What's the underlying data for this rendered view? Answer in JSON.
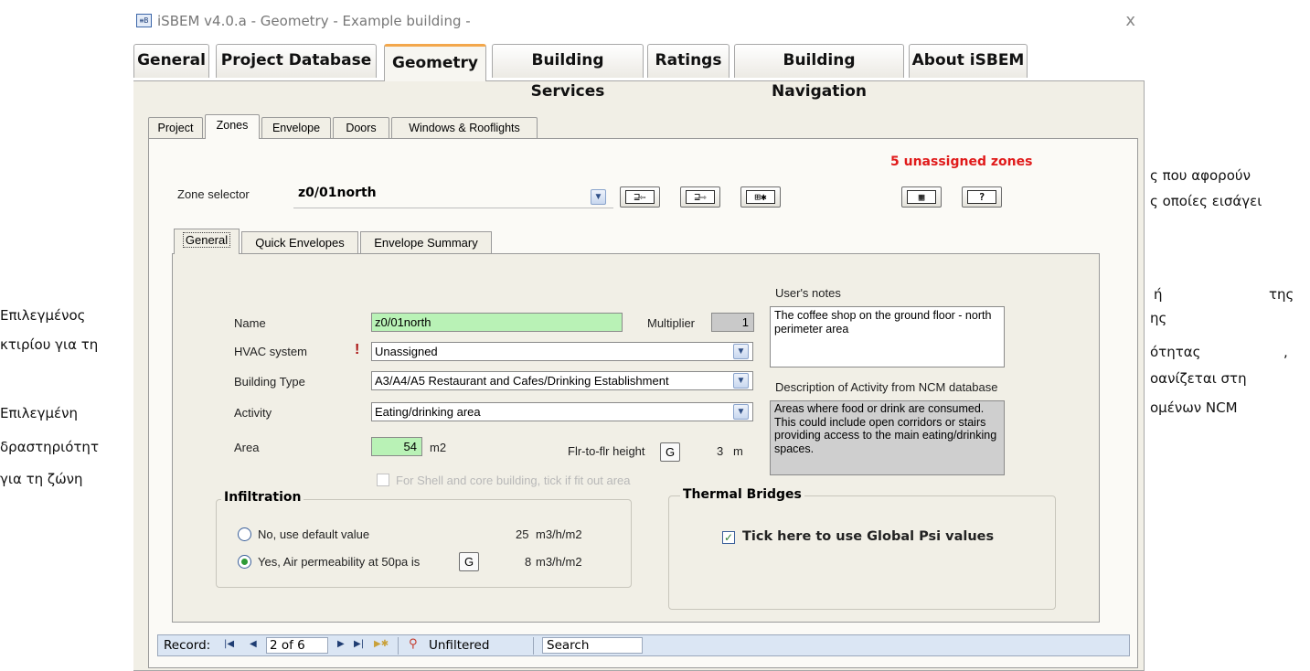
{
  "window": {
    "title": "iSBEM v4.0.a - Geometry - Example building -",
    "icon": "isbem-app-icon",
    "close_glyph": "x"
  },
  "main_tabs": [
    "General",
    "Project Database",
    "Geometry",
    "Building Services",
    "Ratings",
    "Building Navigation",
    "About iSBEM"
  ],
  "sub_tabs": [
    "Project",
    "Zones",
    "Envelope",
    "Doors",
    "Windows & Rooflights"
  ],
  "status": {
    "unassigned": "5 unassigned zones",
    "color": "#e01a1a"
  },
  "zone_selector": {
    "label": "Zone selector",
    "value": "z0/01north"
  },
  "inner_tabs": [
    "General",
    "Quick Envelopes",
    "Envelope Summary"
  ],
  "form": {
    "name_label": "Name",
    "name_value": "z0/01north",
    "multiplier_label": "Multiplier",
    "multiplier_value": "1",
    "hvac_label": "HVAC system",
    "hvac_warning": "!",
    "hvac_value": "Unassigned",
    "building_type_label": "Building Type",
    "building_type_value": "A3/A4/A5 Restaurant and Cafes/Drinking Establishment",
    "activity_label": "Activity",
    "activity_value": "Eating/drinking area",
    "area_label": "Area",
    "area_value": "54",
    "area_unit": "m2",
    "flr_label": "Flr-to-flr height",
    "flr_button": "G",
    "flr_value": "3",
    "flr_unit": "m",
    "shell_core_label": "For Shell and core building, tick if fit out area",
    "notes_label": "User's notes",
    "notes_value": "The coffee shop on the ground floor - north perimeter area",
    "ncm_label": "Description of Activity from NCM database",
    "ncm_value": "Areas where food or drink are consumed. This could include open corridors or stairs providing access to the main eating/drinking spaces."
  },
  "infiltration": {
    "title": "Infiltration",
    "opt1_label": "No, use default value",
    "opt1_value": "25",
    "opt1_unit": "m3/h/m2",
    "opt2_label": "Yes, Air permeability at 50pa is",
    "opt2_button": "G",
    "opt2_value": "8",
    "opt2_unit": "m3/h/m2",
    "selected": "opt2"
  },
  "thermal": {
    "title": "Thermal Bridges",
    "check_label": "Tick here to use Global Psi values",
    "checked": true
  },
  "record": {
    "label": "Record:",
    "value": "2 of 6",
    "filter": "Unfiltered",
    "search": "Search"
  },
  "doc_left": [
    "Επιλεγμένος",
    "κτιρίου για τη",
    "Επιλεγμένη",
    "δραστηριότητ",
    "για τη ζώνη"
  ],
  "doc_right": [
    "ς που αφορούν",
    "ς οποίες εισάγει",
    "ή",
    "της",
    "ης",
    "ότητας",
    ",",
    "οανίζεται στη",
    "ομένων NCM"
  ]
}
